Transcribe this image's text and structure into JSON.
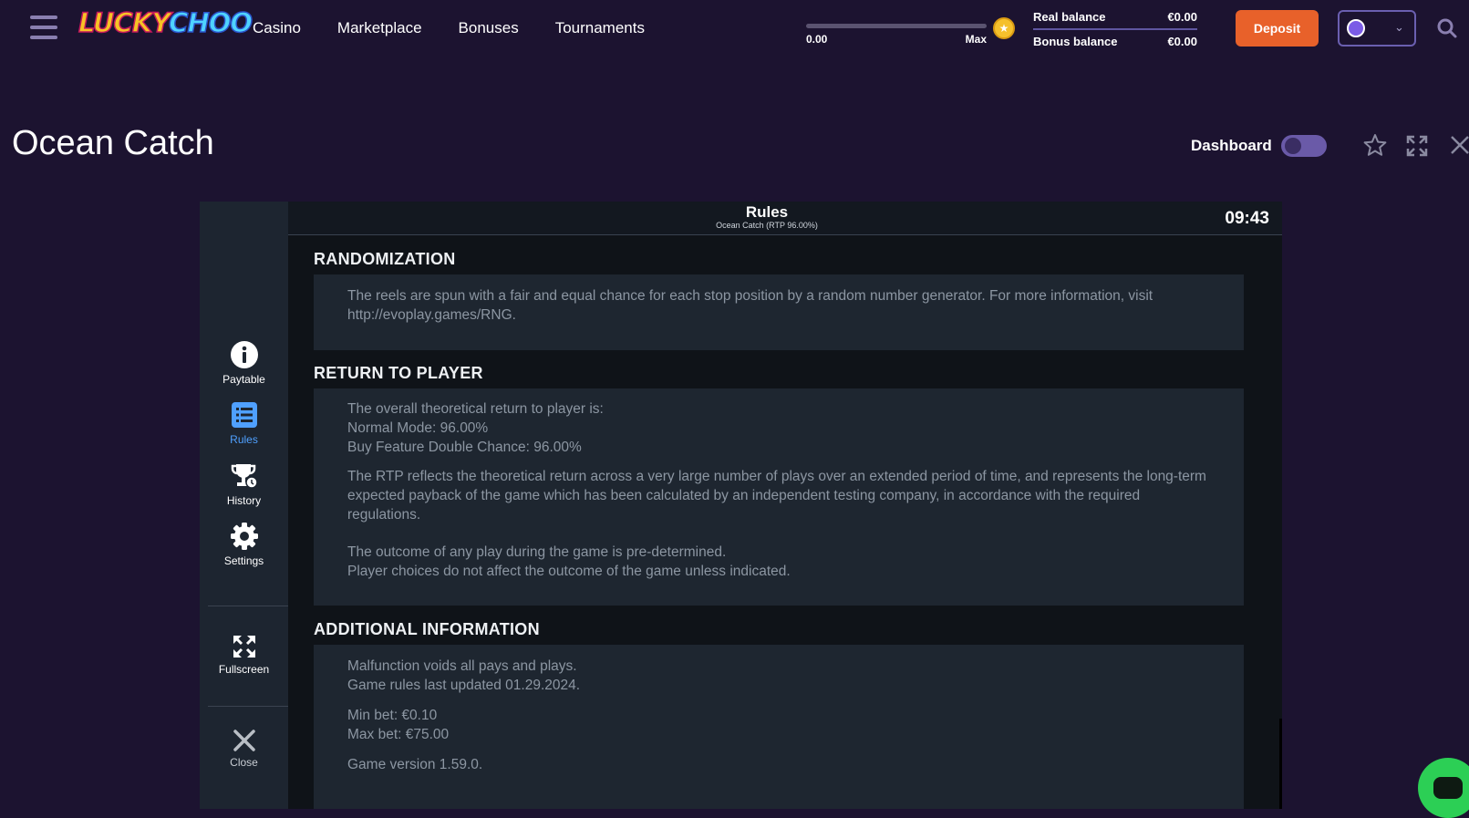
{
  "header": {
    "logo": {
      "part1": "LUCKY",
      "part2": "CHOO"
    },
    "nav": [
      "Casino",
      "Marketplace",
      "Bonuses",
      "Tournaments"
    ],
    "progress": {
      "min_label": "0.00",
      "max_label": "Max",
      "fraction": 0.0
    },
    "balances": {
      "real_label": "Real balance",
      "real_value": "€0.00",
      "bonus_label": "Bonus balance",
      "bonus_value": "€0.00"
    },
    "deposit_label": "Deposit",
    "icons": [
      "menu-icon",
      "coin-icon",
      "avatar-icon",
      "chevron-down-icon",
      "search-icon"
    ]
  },
  "page": {
    "title": "Ocean Catch",
    "dashboard_label": "Dashboard",
    "dashboard_on": false,
    "icons": [
      "star-icon",
      "expand-icon",
      "close-icon"
    ]
  },
  "game": {
    "header": {
      "title": "Rules",
      "subtitle": "Ocean Catch (RTP 96.00%)",
      "time": "09:43"
    },
    "sidebar": [
      {
        "label": "Paytable",
        "icon": "info-icon",
        "active": false
      },
      {
        "label": "Rules",
        "icon": "list-icon",
        "active": true
      },
      {
        "label": "History",
        "icon": "trophy-clock-icon",
        "active": false
      },
      {
        "label": "Settings",
        "icon": "gear-icon",
        "active": false
      },
      {
        "label": "Fullscreen",
        "icon": "fullscreen-icon",
        "active": false
      },
      {
        "label": "Close",
        "icon": "close-icon",
        "active": false
      }
    ],
    "sections": [
      {
        "title": "RANDOMIZATION",
        "paragraphs": [
          "The reels are spun with a fair and equal chance for each stop position by a random number generator. For more information, visit http://evoplay.games/RNG."
        ]
      },
      {
        "title": "RETURN TO PLAYER",
        "paragraphs": [
          "The overall theoretical return to player is:",
          "Normal Mode: 96.00%",
          "Buy Feature Double Chance: 96.00%",
          "The RTP reflects the theoretical return across a very large number of plays over an extended period of time, and represents the long-term expected payback of the game which has been calculated by an independent testing company, in accordance with the required regulations.",
          "The outcome of any play during the game is pre-determined.",
          "Player choices do not affect the outcome of the game unless indicated."
        ]
      },
      {
        "title": "ADDITIONAL INFORMATION",
        "paragraphs": [
          "Malfunction voids all pays and plays.",
          "Game rules last updated 01.29.2024.",
          "Min bet: €0.10",
          "Max bet: €75.00",
          "Game version 1.59.0."
        ]
      }
    ]
  },
  "colors": {
    "background": "#1c1330",
    "deposit": "#e8612a",
    "active_tab": "#4fa0ff",
    "chat": "#2ccf55"
  }
}
